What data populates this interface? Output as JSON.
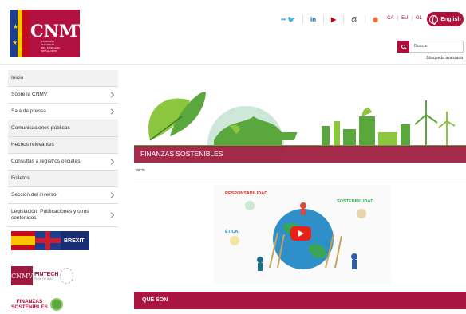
{
  "brand": {
    "logo_text": "CNMV",
    "logo_subtitle": "COMISIÓN NACIONAL DEL MERCADO DE VALORES",
    "accent": "#9b1a3d"
  },
  "header": {
    "social": [
      "twitter-icon",
      "linkedin-icon",
      "youtube-icon",
      "email-icon",
      "rss-icon"
    ],
    "languages": [
      "CA",
      "EU",
      "GL"
    ],
    "english_label": "English",
    "search_placeholder": "Buscar",
    "advanced_search": "Búsqueda avanzada"
  },
  "sidebar": {
    "items": [
      {
        "label": "Inicio",
        "arrow": false
      },
      {
        "label": "Sobre la CNMV",
        "arrow": true
      },
      {
        "label": "Sala de prensa",
        "arrow": true
      },
      {
        "label": "Comunicaciones públicas",
        "arrow": false
      },
      {
        "label": "Hechos relevantes",
        "arrow": false
      },
      {
        "label": "Consultas a registros oficiales",
        "arrow": true
      },
      {
        "label": "Folletos",
        "arrow": false
      },
      {
        "label": "Sección del inversor",
        "arrow": true
      },
      {
        "label": "Legislación, Publicaciones y otros contenidos",
        "arrow": true
      }
    ],
    "promos": {
      "brexit": "BREXIT",
      "fintech_logo": "CNMV",
      "fintech": "FINTECH",
      "fintech_sub": "Portal FinTech",
      "finanzas_line1": "FINANZAS",
      "finanzas_line2": "SOSTENIBLES"
    }
  },
  "main": {
    "banner_title": "FINANZAS SOSTENIBLES",
    "breadcrumb": "Inicio",
    "video_labels": {
      "responsabilidad": "RESPONSABILIDAD",
      "sostenibilidad": "SOSTENIBILIDAD",
      "etica": "ÉTICA"
    },
    "section_title": "QUÉ SON"
  }
}
